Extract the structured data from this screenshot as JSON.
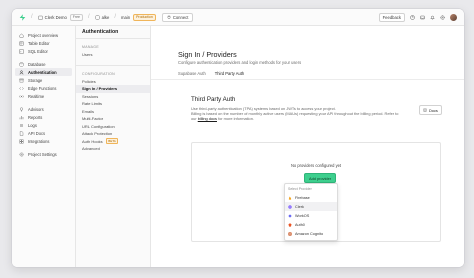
{
  "topbar": {
    "org": "Clerk Demo",
    "org_plan": "Free",
    "project": "alke",
    "branch": "main",
    "env": "Production",
    "connect": "Connect",
    "feedback": "Feedback"
  },
  "leftnav": {
    "items": [
      {
        "label": "Project overview",
        "icon": "home-icon"
      },
      {
        "label": "Table Editor",
        "icon": "table-icon"
      },
      {
        "label": "SQL Editor",
        "icon": "terminal-icon"
      },
      {
        "label": "Database",
        "icon": "database-icon"
      },
      {
        "label": "Authentication",
        "icon": "users-icon"
      },
      {
        "label": "Storage",
        "icon": "archive-icon"
      },
      {
        "label": "Edge Functions",
        "icon": "code-icon"
      },
      {
        "label": "Realtime",
        "icon": "realtime-icon"
      },
      {
        "label": "Advisors",
        "icon": "lightbulb-icon"
      },
      {
        "label": "Reports",
        "icon": "chart-icon"
      },
      {
        "label": "Logs",
        "icon": "list-icon"
      },
      {
        "label": "API Docs",
        "icon": "document-icon"
      },
      {
        "label": "Integrations",
        "icon": "puzzle-icon"
      },
      {
        "label": "Project Settings",
        "icon": "gear-icon"
      }
    ]
  },
  "submenu": {
    "title": "Authentication",
    "manage_section": "MANAGE",
    "manage_items": [
      "Users"
    ],
    "config_section": "CONFIGURATION",
    "config_items": [
      "Policies",
      "Sign In / Providers",
      "Sessions",
      "Rate Limits",
      "Emails",
      "Multi-Factor",
      "URL Configuration",
      "Attack Protection",
      "Auth Hooks",
      "Advanced"
    ],
    "beta_label": "BETA"
  },
  "main": {
    "title": "Sign In / Providers",
    "subtitle": "Configure authentication providers and login methods for your users",
    "tabs": [
      "Supabase Auth",
      "Third Party Auth"
    ],
    "section_title": "Third Party Auth",
    "desc_line1": "Use third-party authentication (TPA) systems based on JWTs to access your project.",
    "desc_line2": "Billing is based on the number of monthly active users (MAUs) requesting your API throughout the billing period. Refer to",
    "desc_line3_pre": "our",
    "desc_link": "billing docs",
    "desc_line3_post": "for more information.",
    "docs_button": "Docs",
    "empty_text": "No providers configured yet",
    "add_button": "Add provider"
  },
  "dropdown": {
    "label": "Select Provider",
    "items": [
      {
        "label": "Firebase",
        "color": "#f5a623"
      },
      {
        "label": "Clerk",
        "color": "#6c47ff"
      },
      {
        "label": "WorkOS",
        "color": "#6363f1"
      },
      {
        "label": "Auth0",
        "color": "#eb5424"
      },
      {
        "label": "Amazon Cognito",
        "color": "#c7511f"
      }
    ]
  }
}
